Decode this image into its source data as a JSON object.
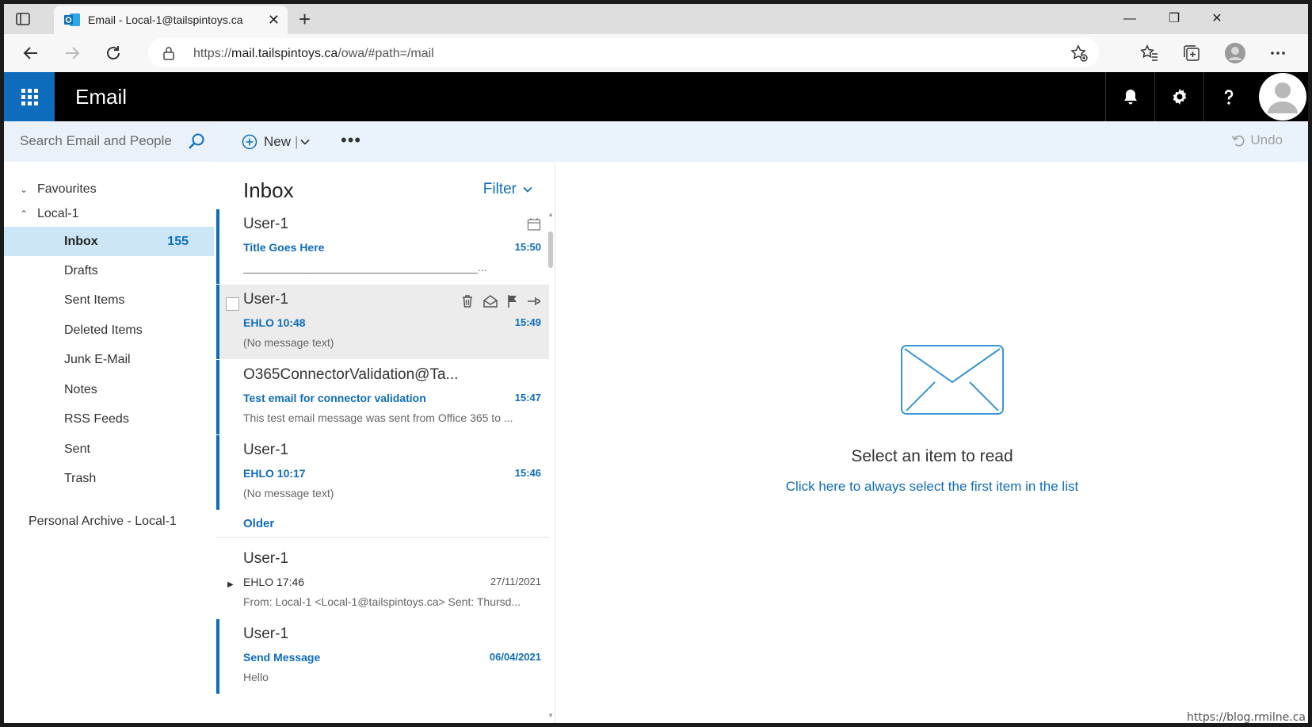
{
  "browser": {
    "tab_title": "Email - Local-1@tailspintoys.ca",
    "tab_close": "✕",
    "new_tab": "+",
    "url_scheme": "https://",
    "url_host": "mail.tailspintoys.ca",
    "url_path": "/owa/#path=/mail",
    "window_minimize": "—",
    "window_restore": "❐",
    "window_close": "✕"
  },
  "header": {
    "app_title": "Email"
  },
  "search": {
    "placeholder": "Search Email and People"
  },
  "toolbar": {
    "new_label": "New",
    "new_sep": "|",
    "more_label": "•••",
    "undo_label": "Undo"
  },
  "folders": {
    "favourites_label": "Favourites",
    "account_label": "Local-1",
    "items": [
      {
        "label": "Inbox",
        "count": "155"
      },
      {
        "label": "Drafts"
      },
      {
        "label": "Sent Items"
      },
      {
        "label": "Deleted Items"
      },
      {
        "label": "Junk E-Mail"
      },
      {
        "label": "Notes"
      },
      {
        "label": "RSS Feeds"
      },
      {
        "label": "Sent"
      },
      {
        "label": "Trash"
      }
    ],
    "archive_label": "Personal Archive - Local-1"
  },
  "list": {
    "title": "Inbox",
    "filter_label": "Filter",
    "older_label": "Older",
    "messages": [
      {
        "sender": "User-1",
        "subject": "Title Goes Here",
        "time": "15:50",
        "preview": "______________________________________..."
      },
      {
        "sender": "User-1",
        "subject": "EHLO 10:48",
        "time": "15:49",
        "preview": "(No message text)"
      },
      {
        "sender": "O365ConnectorValidation@Ta...",
        "subject": "Test email for connector validation",
        "time": "15:47",
        "preview": "This test email message was sent from Office 365 to ..."
      },
      {
        "sender": "User-1",
        "subject": "EHLO 10:17",
        "time": "15:46",
        "preview": "(No message text)"
      },
      {
        "sender": "User-1",
        "subject": "EHLO 17:46",
        "time": "27/11/2021",
        "preview": "From: Local-1 <Local-1@tailspintoys.ca> Sent: Thursd..."
      },
      {
        "sender": "User-1",
        "subject": "Send Message",
        "time": "06/04/2021",
        "preview": "Hello"
      }
    ]
  },
  "reading": {
    "message": "Select an item to read",
    "link": "Click here to always select the first item in the list"
  },
  "watermark": "https://blog.rmilne.ca",
  "colors": {
    "accent": "#0f6cbd",
    "header_bg": "#000000",
    "selected_folder": "#cde6f7"
  }
}
